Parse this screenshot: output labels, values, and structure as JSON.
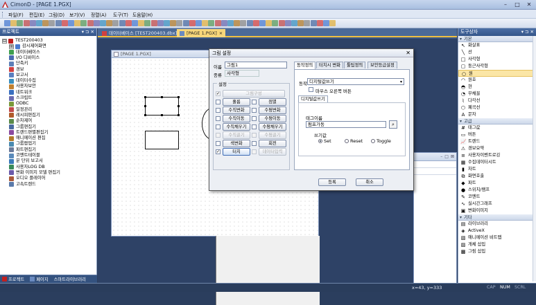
{
  "window": {
    "title": "CimonD - [PAGE 1.PGX]",
    "buttons": [
      "–",
      "□",
      "✕"
    ]
  },
  "menu": [
    "파일(F)",
    "편집(E)",
    "그림(D)",
    "보기(V)",
    "정렬(A)",
    "도구(T)",
    "도움말(H)"
  ],
  "left_panel": {
    "title": "프로젝트",
    "tree": [
      {
        "label": "TEST200403",
        "color": "#c02020",
        "expander": "⊟"
      },
      {
        "label": "감시제어화면",
        "color": "#4a7bd0",
        "expander": "⊞"
      },
      {
        "label": "데이터베이스",
        "color": "#3f9f4f"
      },
      {
        "label": "I/O 디바이스",
        "color": "#4a6ab0"
      },
      {
        "label": "단축키",
        "color": "#5d7fb8"
      },
      {
        "label": "경보",
        "color": "#d04040"
      },
      {
        "label": "보고서",
        "color": "#5a7fbf"
      },
      {
        "label": "데이터수집",
        "color": "#3a8fbf"
      },
      {
        "label": "사용자보안",
        "color": "#c08030"
      },
      {
        "label": "네트워크",
        "color": "#3a6fbf"
      },
      {
        "label": "스크립트",
        "color": "#6a6ab0"
      },
      {
        "label": "ODBC",
        "color": "#7a9a3a"
      },
      {
        "label": "일정관리",
        "color": "#c04a4a"
      },
      {
        "label": "레시피편집기",
        "color": "#b05a2a"
      },
      {
        "label": "순차제어",
        "color": "#5a8a4a"
      },
      {
        "label": "그룹편집기",
        "color": "#4a6aa0"
      },
      {
        "label": "트랜드편별편집기",
        "color": "#8a4aa0"
      },
      {
        "label": "애니메이션 편집",
        "color": "#b07a2a"
      },
      {
        "label": "그룹팝업기",
        "color": "#4a8ab0"
      },
      {
        "label": "파트편집기",
        "color": "#6a7a9a"
      },
      {
        "label": "코멘트테이블",
        "color": "#5a8aba"
      },
      {
        "label": "분 단위 보고서",
        "color": "#3a7aba"
      },
      {
        "label": "사용자LOG DB",
        "color": "#3a8a5a"
      },
      {
        "label": "변화 이미지 모델 편집기",
        "color": "#6a5aaa"
      },
      {
        "label": "오디오 플레이어",
        "color": "#aa5a3a"
      },
      {
        "label": "고속트렌드",
        "color": "#5a7aaa"
      }
    ],
    "tabs": [
      "프로젝트",
      "페이지",
      "스마트라이브러리"
    ]
  },
  "doc_tabs": [
    {
      "label": "데이터베이스 [TEST200403.dbx]",
      "active": false
    },
    {
      "label": "[PAGE 1.PGX]",
      "active": true,
      "close": "×"
    }
  ],
  "page_window": {
    "title": "[PAGE 1.PGX]"
  },
  "bg_window": {
    "buttons": [
      "–",
      "□",
      "⊠"
    ]
  },
  "dialog": {
    "title": "그림 설정",
    "close": "✕",
    "name_label": "이름",
    "name_value": "그림1",
    "type_label": "종류",
    "type_value": "사각형",
    "settings_label": "설정",
    "buttons_left": [
      {
        "label": "그림구성",
        "checked": true,
        "disabled": true,
        "wide": true
      },
      {
        "label": "흘름",
        "checked": false
      },
      {
        "label": "수직변화",
        "checked": false
      },
      {
        "label": "수직이동",
        "checked": false
      },
      {
        "label": "수직채우기",
        "checked": false
      },
      {
        "label": "수직끌기",
        "checked": false,
        "disabled": true
      },
      {
        "label": "색변화",
        "checked": false
      },
      {
        "label": "터치",
        "checked": true,
        "highlight": true
      }
    ],
    "buttons_right": [
      {
        "label": "점멸",
        "checked": false
      },
      {
        "label": "수평변화",
        "checked": false
      },
      {
        "label": "수평이동",
        "checked": false
      },
      {
        "label": "수평채우기",
        "checked": false
      },
      {
        "label": "수평끌기",
        "checked": false,
        "disabled": true
      },
      {
        "label": "회전",
        "checked": false
      },
      {
        "label": "데이터입력",
        "checked": false,
        "disabled": true
      }
    ],
    "tabs": [
      "동작정의",
      "터치시 변화",
      "툴팁정의",
      "보안등급설정"
    ],
    "action_label": "동작",
    "action_value": "디지털값쓰기",
    "mouse_right_label": "마우스 오른쪽 버튼",
    "subtab": "디지털값쓰기",
    "tag_label": "태그이름",
    "tag_value": "펌프가동",
    "write_label": "쓰기값",
    "radios": [
      {
        "label": "Set",
        "on": true
      },
      {
        "label": "Reset",
        "on": false
      },
      {
        "label": "Toggle",
        "on": false
      }
    ],
    "ok": "등록",
    "cancel": "취소"
  },
  "right_panel": {
    "title": "도구상자",
    "sections": [
      {
        "name": "기본",
        "items": [
          {
            "label": "화살표",
            "icon": "↖"
          },
          {
            "label": "선",
            "icon": "╲"
          },
          {
            "label": "사각형",
            "icon": "□"
          },
          {
            "label": "둥근사각형",
            "icon": "▢"
          },
          {
            "label": "원",
            "icon": "○",
            "selected": true
          },
          {
            "label": "원호",
            "icon": "◠"
          },
          {
            "label": "현",
            "icon": "◓"
          },
          {
            "label": "부채꼴",
            "icon": "◔"
          },
          {
            "label": "다각선",
            "icon": "⌇"
          },
          {
            "label": "폐곡선",
            "icon": "⬡"
          },
          {
            "label": "문자",
            "icon": "A"
          }
        ]
      },
      {
        "name": "고급",
        "items": [
          {
            "label": "태그값",
            "icon": "#"
          },
          {
            "label": "버튼",
            "icon": "▭"
          },
          {
            "label": "트렌드",
            "icon": "📈"
          },
          {
            "label": "경보요약",
            "icon": "⚠"
          },
          {
            "label": "사용자이벤트로깅",
            "icon": "≡"
          },
          {
            "label": "수집데이터시트",
            "icon": "▦"
          },
          {
            "label": "차트",
            "icon": "▮"
          },
          {
            "label": "화면호출",
            "icon": "⧉"
          },
          {
            "label": "파트",
            "icon": "◆"
          },
          {
            "label": "스위치/램프",
            "icon": "●"
          },
          {
            "label": "코멘트",
            "icon": "✎"
          },
          {
            "label": "실시간그래프",
            "icon": "∿"
          },
          {
            "label": "변화이미지",
            "icon": "▣"
          }
        ]
      },
      {
        "name": "기타",
        "items": [
          {
            "label": "라이브러리",
            "icon": "▤"
          },
          {
            "label": "ActiveX",
            "icon": "◈"
          },
          {
            "label": "애니메이션 비트맵",
            "icon": "▧"
          },
          {
            "label": "개체 삽입",
            "icon": "▨"
          },
          {
            "label": "그림 삽입",
            "icon": "▩"
          }
        ]
      }
    ]
  },
  "status": {
    "coord": "x=43, y=333",
    "indicators": [
      "CAP",
      "NUM",
      "SCRL"
    ]
  },
  "colors": {
    "accent": "#f7d77a",
    "panel_header": "#3f6298",
    "status_bar": "#2a3d5c"
  }
}
